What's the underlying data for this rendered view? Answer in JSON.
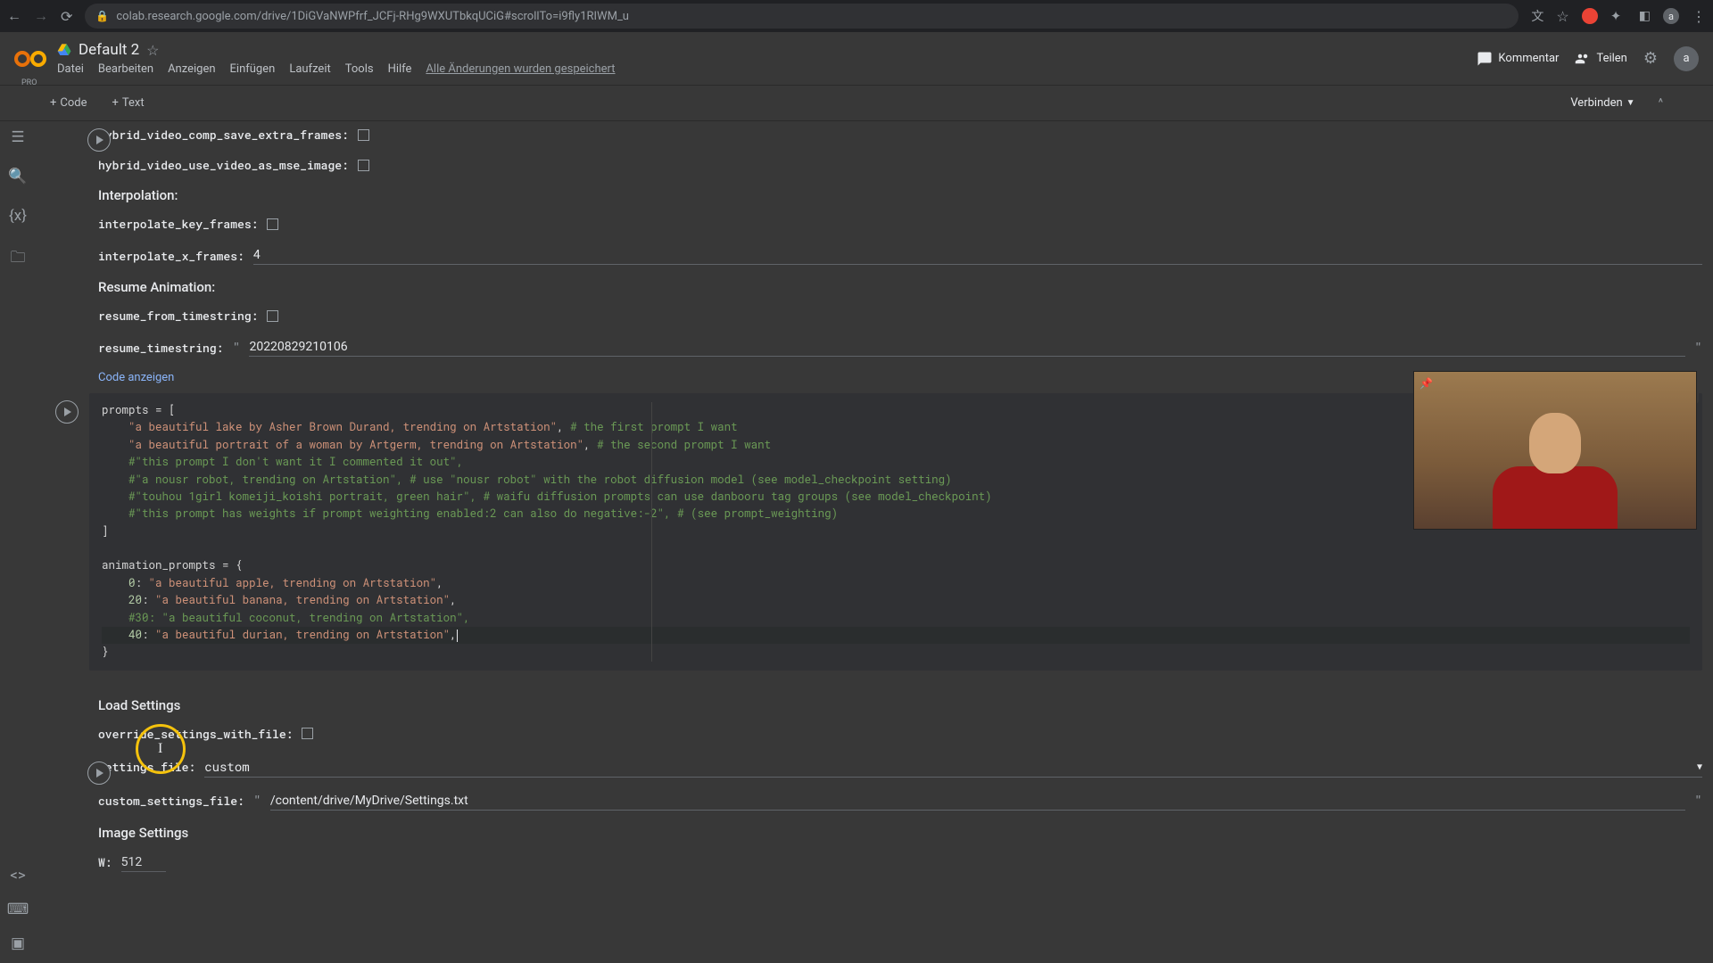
{
  "browser": {
    "url": "colab.research.google.com/drive/1DiGVaNWPfrf_JCFj-RHg9WXUTbkqUCiG#scrollTo=i9fly1RIWM_u"
  },
  "header": {
    "pro": "PRO",
    "title": "Default 2",
    "menu": [
      "Datei",
      "Bearbeiten",
      "Anzeigen",
      "Einfügen",
      "Laufzeit",
      "Tools",
      "Hilfe"
    ],
    "save_status": "Alle Änderungen wurden gespeichert",
    "comment": "Kommentar",
    "share": "Teilen",
    "avatar": "a"
  },
  "toolbar": {
    "code": "Code",
    "text": "Text",
    "connect": "Verbinden"
  },
  "form1": {
    "hybrid_save_extra": "hybrid_video_comp_save_extra_frames:",
    "hybrid_mse": "hybrid_video_use_video_as_mse_image:",
    "interpolation_header": "Interpolation:",
    "interpolate_key": "interpolate_key_frames:",
    "interpolate_x": "interpolate_x_frames:",
    "interpolate_x_val": "4",
    "resume_header": "Resume Animation:",
    "resume_from": "resume_from_timestring:",
    "resume_ts_label": "resume_timestring:",
    "resume_ts_val": "20220829210106",
    "show_code": "Code anzeigen"
  },
  "code_cell": {
    "lines": [
      {
        "t": "plain",
        "text": "prompts = ["
      },
      {
        "t": "str_comment",
        "indent": "    ",
        "str": "\"a beautiful lake by Asher Brown Durand, trending on Artstation\"",
        "mid": ", ",
        "comment": "# the first prompt I want"
      },
      {
        "t": "str_comment",
        "indent": "    ",
        "str": "\"a beautiful portrait of a woman by Artgerm, trending on Artstation\"",
        "mid": ", ",
        "comment": "# the second prompt I want"
      },
      {
        "t": "comment",
        "indent": "    ",
        "text": "#\"this prompt I don't want it I commented it out\","
      },
      {
        "t": "comment",
        "indent": "    ",
        "text": "#\"a nousr robot, trending on Artstation\", # use \"nousr robot\" with the robot diffusion model (see model_checkpoint setting)"
      },
      {
        "t": "comment",
        "indent": "    ",
        "text": "#\"touhou 1girl komeiji_koishi portrait, green hair\", # waifu diffusion prompts can use danbooru tag groups (see model_checkpoint)"
      },
      {
        "t": "comment",
        "indent": "    ",
        "text": "#\"this prompt has weights if prompt weighting enabled:2 can also do negative:-2\", # (see prompt_weighting)"
      },
      {
        "t": "plain",
        "text": "]"
      },
      {
        "t": "blank"
      },
      {
        "t": "plain",
        "text": "animation_prompts = {"
      },
      {
        "t": "kv",
        "indent": "    ",
        "key": "0",
        "val": "\"a beautiful apple, trending on Artstation\"",
        "tail": ","
      },
      {
        "t": "kv",
        "indent": "    ",
        "key": "20",
        "val": "\"a beautiful banana, trending on Artstation\"",
        "tail": ","
      },
      {
        "t": "comment",
        "indent": "    ",
        "text": "#30: \"a beautiful coconut, trending on Artstation\","
      },
      {
        "t": "kv",
        "indent": "    ",
        "key": "40",
        "val": "\"a beautiful durian, trending on Artstation\"",
        "tail": ",",
        "cursor": true
      },
      {
        "t": "plain",
        "text": "}"
      }
    ]
  },
  "form2": {
    "load_header": "Load Settings",
    "override_label": "override_settings_with_file:",
    "settings_file_label": "settings_file:",
    "settings_file_val": "custom",
    "custom_file_label": "custom_settings_file:",
    "custom_file_val": "/content/drive/MyDrive/Settings.txt",
    "image_header": "Image Settings",
    "w_label": "W:",
    "w_val": "512"
  },
  "chart_data": null
}
